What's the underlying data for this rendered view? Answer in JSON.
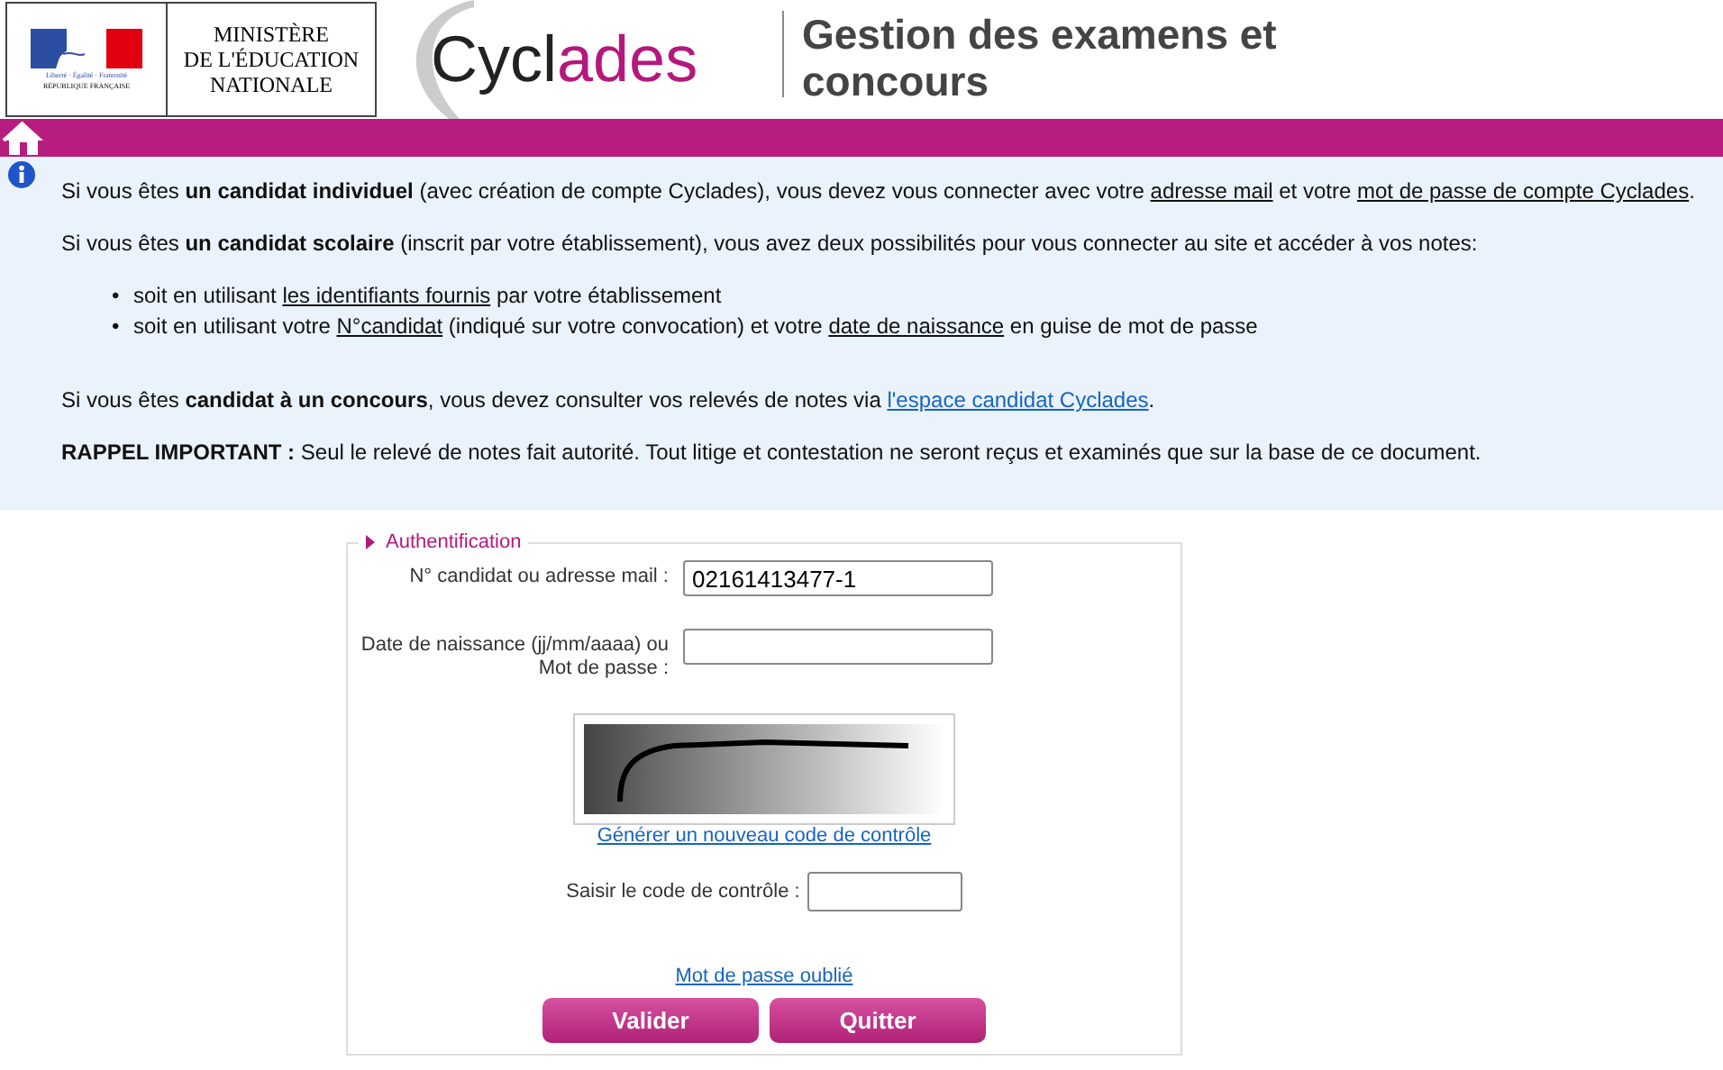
{
  "header": {
    "ministry_logo": {
      "motto": "Liberté · Égalité · Fraternité",
      "country": "RÉPUBLIQUE FRANÇAISE"
    },
    "ministry_name": [
      "MINISTÈRE",
      "DE L'ÉDUCATION",
      "NATIONALE"
    ],
    "app_logo": [
      {
        "text": "Cycl",
        "accent": false
      },
      {
        "text": "ades",
        "accent": true
      }
    ],
    "title": "Gestion des examens et concours"
  },
  "info": {
    "paragraphs": [
      {
        "kind": "para",
        "parts": [
          {
            "kind": "plain",
            "text": "Si vous êtes "
          },
          {
            "kind": "bold",
            "text": "un candidat individuel"
          },
          {
            "kind": "plain",
            "text": " (avec création de compte Cyclades), vous devez vous connecter avec votre "
          },
          {
            "kind": "underline",
            "text": "adresse mail"
          },
          {
            "kind": "plain",
            "text": " et votre "
          },
          {
            "kind": "underline",
            "text": "mot de passe de compte Cyclades"
          },
          {
            "kind": "plain",
            "text": "."
          }
        ]
      },
      {
        "kind": "para",
        "parts": [
          {
            "kind": "plain",
            "text": "Si vous êtes "
          },
          {
            "kind": "bold",
            "text": "un candidat scolaire"
          },
          {
            "kind": "plain",
            "text": " (inscrit par votre établissement), vous avez deux possibilités pour vous connecter au site et accéder à vos notes:"
          }
        ]
      },
      {
        "kind": "bullet",
        "marker": "•",
        "parts": [
          {
            "kind": "plain",
            "text": "soit en utilisant "
          },
          {
            "kind": "underline",
            "text": "les identifiants fournis"
          },
          {
            "kind": "plain",
            "text": " par votre établissement"
          }
        ]
      },
      {
        "kind": "bullet",
        "marker": "•",
        "parts": [
          {
            "kind": "plain",
            "text": "soit en utilisant votre "
          },
          {
            "kind": "underline",
            "text": "N°candidat"
          },
          {
            "kind": "plain",
            "text": " (indiqué sur votre convocation) et votre "
          },
          {
            "kind": "underline",
            "text": "date de naissance"
          },
          {
            "kind": "plain",
            "text": " en guise de mot de passe"
          }
        ]
      },
      {
        "kind": "spaced",
        "parts": [
          {
            "kind": "plain",
            "text": "Si vous êtes "
          },
          {
            "kind": "bold",
            "text": "candidat à un concours"
          },
          {
            "kind": "plain",
            "text": ", vous devez consulter vos relevés de notes via "
          },
          {
            "kind": "link",
            "text": "l'espace candidat Cyclades"
          },
          {
            "kind": "plain",
            "text": "."
          }
        ]
      },
      {
        "kind": "para",
        "parts": [
          {
            "kind": "bold",
            "text": "RAPPEL IMPORTANT :"
          },
          {
            "kind": "plain",
            "text": " Seul le relevé de notes fait autorité. Tout litige et contestation ne seront reçus et examinés que sur la base de ce document."
          }
        ]
      }
    ]
  },
  "form": {
    "legend": "Authentification",
    "fields": [
      {
        "label": "N° candidat ou adresse mail :",
        "value": "02161413477-1"
      },
      {
        "label": "Date de naissance (jj/mm/aaaa) ou Mot de passe :"
      }
    ],
    "captcha": {
      "kind": "picture"
    },
    "regenerate_link": "Générer un nouveau code de contrôle",
    "code_label": "Saisir le code de contrôle :",
    "forgot_link": "Mot de passe oublié",
    "buttons": [
      "Valider",
      "Quitter"
    ]
  }
}
